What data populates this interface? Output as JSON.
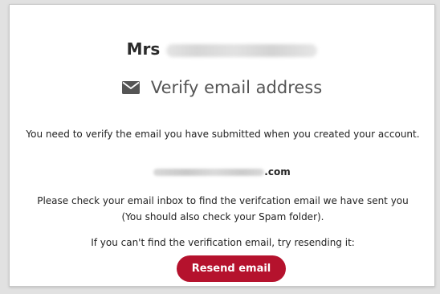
{
  "greeting": {
    "salutation": "Mrs"
  },
  "header": {
    "icon": "envelope-icon",
    "title": "Verify email address"
  },
  "message": {
    "line1": "You need to verify the email you have submitted when you created your account.",
    "email_suffix": ".com",
    "line2": "Please check your email inbox to find the verifcation email we have sent you (You should also check your Spam folder).",
    "line3": "If you can't find the verification email, try resending it:"
  },
  "actions": {
    "resend_label": "Resend email"
  },
  "colors": {
    "accent": "#b5122d",
    "title": "#555555"
  }
}
